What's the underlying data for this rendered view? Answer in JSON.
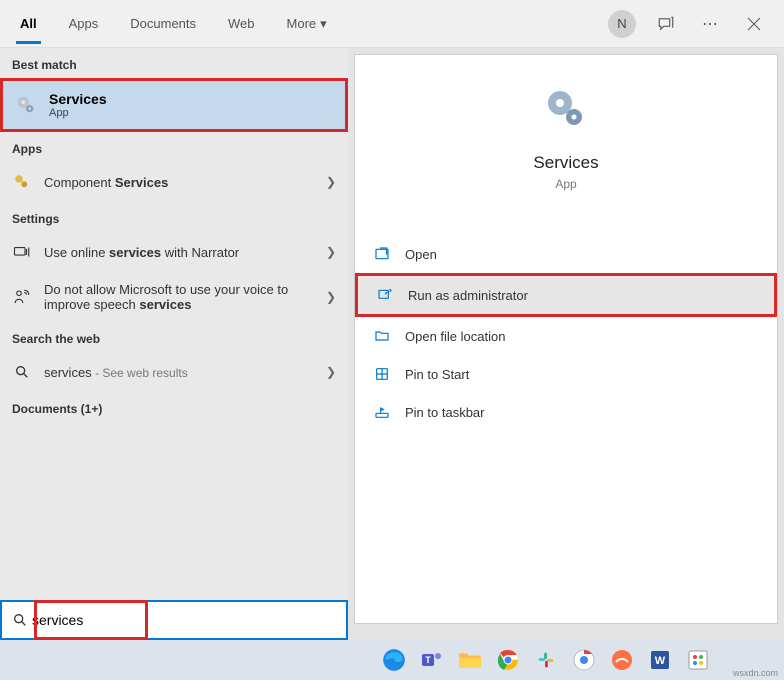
{
  "header": {
    "tabs": [
      "All",
      "Apps",
      "Documents",
      "Web",
      "More"
    ],
    "avatar_initial": "N"
  },
  "left": {
    "best_match_label": "Best match",
    "best_match": {
      "title": "Services",
      "sub": "App"
    },
    "apps_label": "Apps",
    "apps": [
      {
        "label_pre": "Component ",
        "label_bold": "Services"
      }
    ],
    "settings_label": "Settings",
    "settings": [
      {
        "pre": "Use online ",
        "bold": "services",
        "post": " with Narrator"
      },
      {
        "pre": "Do not allow Microsoft to use your voice to improve speech ",
        "bold": "services",
        "post": ""
      }
    ],
    "web_label": "Search the web",
    "web": [
      {
        "term": "services",
        "hint": " - See web results"
      }
    ],
    "documents_label": "Documents (1+)"
  },
  "preview": {
    "title": "Services",
    "sub": "App",
    "actions": [
      "Open",
      "Run as administrator",
      "Open file location",
      "Pin to Start",
      "Pin to taskbar"
    ]
  },
  "search": {
    "value": "services"
  },
  "watermark": "wsxdn.com"
}
